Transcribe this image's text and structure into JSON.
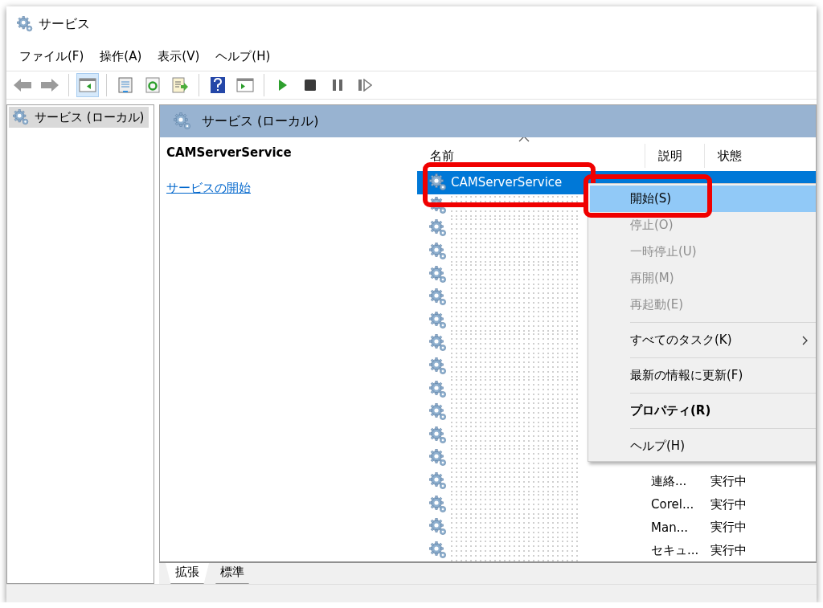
{
  "window": {
    "title": "サービス"
  },
  "menu": [
    {
      "label": "ファイル(F)"
    },
    {
      "label": "操作(A)"
    },
    {
      "label": "表示(V)"
    },
    {
      "label": "ヘルプ(H)"
    }
  ],
  "toolbar": [
    {
      "kind": "back",
      "disabled": true
    },
    {
      "kind": "forward",
      "disabled": true
    },
    {
      "kind": "separator"
    },
    {
      "kind": "tree",
      "pressed": true
    },
    {
      "kind": "separator"
    },
    {
      "kind": "properties",
      "pressed": false
    },
    {
      "kind": "refresh",
      "pressed": false
    },
    {
      "kind": "export",
      "pressed": false
    },
    {
      "kind": "separator"
    },
    {
      "kind": "help",
      "pressed": false
    },
    {
      "kind": "actionpane",
      "pressed": false
    },
    {
      "kind": "separator"
    },
    {
      "kind": "play",
      "pressed": false
    },
    {
      "kind": "stop",
      "pressed": false
    },
    {
      "kind": "pause",
      "pressed": false
    },
    {
      "kind": "resume",
      "pressed": false
    }
  ],
  "tree": {
    "items": [
      {
        "label": "サービス (ローカル)",
        "selected": true
      }
    ]
  },
  "pane": {
    "title": "サービス (ローカル)",
    "service_name": "CAMServerService",
    "start_link": "サービスの開始"
  },
  "table": {
    "columns": [
      {
        "label": "名前",
        "sorted": true
      },
      {
        "label": "説明"
      },
      {
        "label": "状態"
      }
    ],
    "rows": [
      {
        "name": "CAMServerService",
        "selected": true,
        "highlighted": true
      },
      {
        "selected": false
      },
      {
        "selected": false
      },
      {
        "selected": false
      },
      {
        "selected": false
      },
      {
        "selected": false
      },
      {
        "selected": false
      },
      {
        "selected": false
      },
      {
        "selected": false
      },
      {
        "selected": false
      },
      {
        "selected": false
      },
      {
        "selected": false
      },
      {
        "selected": false
      },
      {
        "selected": false,
        "description": "連絡...",
        "status": "実行中"
      },
      {
        "selected": false,
        "description": "Corel...",
        "status": "実行中"
      },
      {
        "selected": false,
        "description": "Man...",
        "status": "実行中"
      },
      {
        "selected": false,
        "description": "セキュ...",
        "status": "実行中"
      }
    ]
  },
  "context_menu": [
    {
      "kind": "item",
      "label": "開始(S)",
      "selected": true,
      "highlighted": true,
      "disabled": false
    },
    {
      "kind": "item",
      "label": "停止(O)",
      "selected": false,
      "disabled": true
    },
    {
      "kind": "item",
      "label": "一時停止(U)",
      "selected": false,
      "disabled": true
    },
    {
      "kind": "item",
      "label": "再開(M)",
      "selected": false,
      "disabled": true
    },
    {
      "kind": "item",
      "label": "再起動(E)",
      "selected": false,
      "disabled": true
    },
    {
      "kind": "separator"
    },
    {
      "kind": "item",
      "label": "すべてのタスク(K)",
      "selected": false,
      "disabled": false,
      "submenu": true
    },
    {
      "kind": "separator"
    },
    {
      "kind": "item",
      "label": "最新の情報に更新(F)",
      "selected": false,
      "disabled": false
    },
    {
      "kind": "separator"
    },
    {
      "kind": "item",
      "label": "プロパティ(R)",
      "selected": false,
      "disabled": false,
      "bold": true
    },
    {
      "kind": "separator"
    },
    {
      "kind": "item",
      "label": "ヘルプ(H)",
      "selected": false,
      "disabled": false
    }
  ],
  "tabs": [
    {
      "label": "拡張",
      "selected": true
    },
    {
      "label": "標準",
      "selected": false
    }
  ]
}
